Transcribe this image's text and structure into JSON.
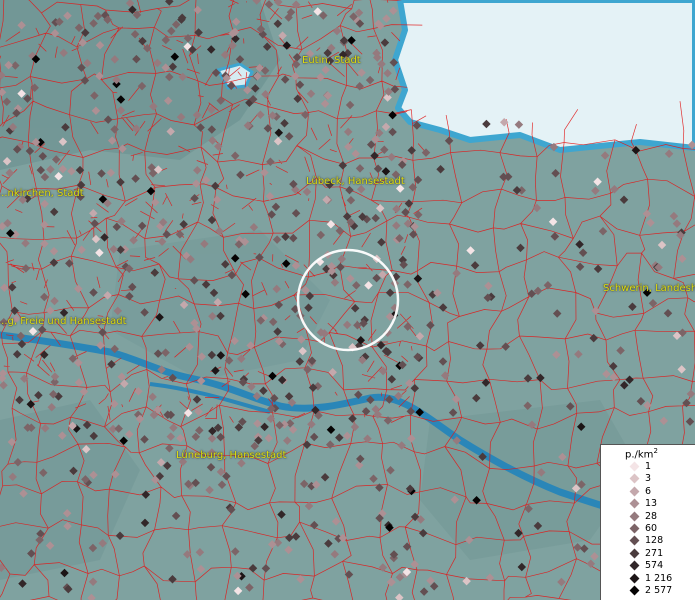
{
  "map": {
    "cities": [
      {
        "id": "eutin",
        "label": "Eutin, Stadt"
      },
      {
        "id": "luebeck",
        "label": "Lübeck, Hansestadt"
      },
      {
        "id": "neumuenster",
        "label": "...nkirchen, Stadt"
      },
      {
        "id": "hamburg",
        "label": "...g, Freie und Hansestadt"
      },
      {
        "id": "schwerin",
        "label": "Schwerin, Landesh..."
      },
      {
        "id": "lueneburg",
        "label": "Lüneburg, Hansestadt"
      }
    ],
    "colors": {
      "land": "#7fa2a0",
      "sea": "#e4f2f6",
      "coast": "#3ea6d0",
      "river": "#2a86b8",
      "borders": "#e01a1a",
      "selection_circle": "#ffffff"
    }
  },
  "legend": {
    "title": "p./km",
    "title_sup": "2",
    "items": [
      {
        "label": "1",
        "color": "#f4e4e6"
      },
      {
        "label": "3",
        "color": "#dcc4c6"
      },
      {
        "label": "6",
        "color": "#c4a8ac"
      },
      {
        "label": "13",
        "color": "#ad9094"
      },
      {
        "label": "28",
        "color": "#957a7e"
      },
      {
        "label": "60",
        "color": "#7c6467"
      },
      {
        "label": "128",
        "color": "#634f52"
      },
      {
        "label": "271",
        "color": "#4a3b3d"
      },
      {
        "label": "574",
        "color": "#322729"
      },
      {
        "label": "1 216",
        "color": "#1c1516"
      },
      {
        "label": "2 577",
        "color": "#050303"
      }
    ]
  }
}
